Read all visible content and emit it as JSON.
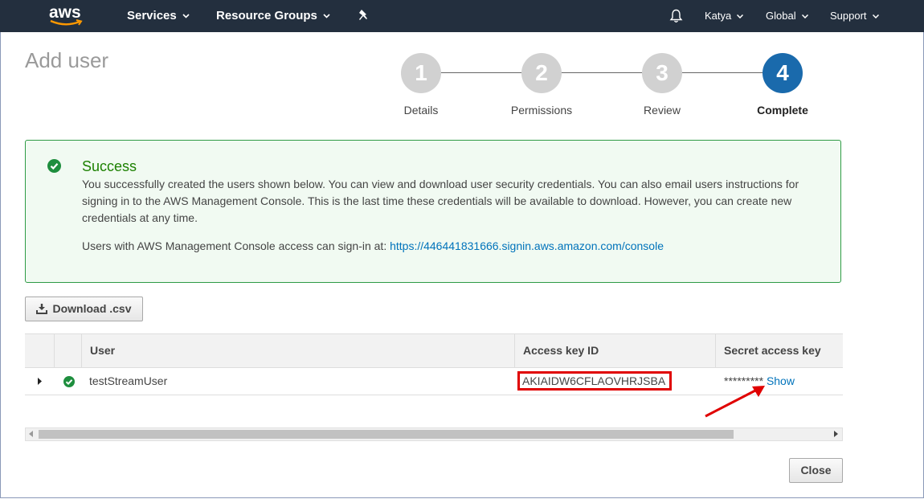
{
  "nav": {
    "logo_text": "aws",
    "services": "Services",
    "resource_groups": "Resource Groups",
    "user": "Katya",
    "region": "Global",
    "support": "Support"
  },
  "page": {
    "title": "Add user"
  },
  "steps": [
    {
      "number": "1",
      "label": "Details"
    },
    {
      "number": "2",
      "label": "Permissions"
    },
    {
      "number": "3",
      "label": "Review"
    },
    {
      "number": "4",
      "label": "Complete"
    }
  ],
  "active_step": 4,
  "success": {
    "title": "Success",
    "message": "You successfully created the users shown below. You can view and download user security credentials. You can also email users instructions for signing in to the AWS Management Console. This is the last time these credentials will be available to download. However, you can create new credentials at any time.",
    "console_text": "Users with AWS Management Console access can sign-in at: ",
    "console_link": "https://446441831666.signin.aws.amazon.com/console"
  },
  "actions": {
    "download_csv": "Download .csv",
    "close": "Close"
  },
  "table": {
    "columns": [
      "User",
      "Access key ID",
      "Secret access key"
    ],
    "rows": [
      {
        "user": "testStreamUser",
        "access_key_id": "AKIAIDW6CFLAOVHRJSBA",
        "secret_masked": "*********",
        "show_label": "Show"
      }
    ]
  },
  "colors": {
    "nav_bg": "#232f3e",
    "accent": "#1a6aac",
    "success": "#1d8102",
    "link": "#0073bb",
    "highlight": "#e00000"
  }
}
